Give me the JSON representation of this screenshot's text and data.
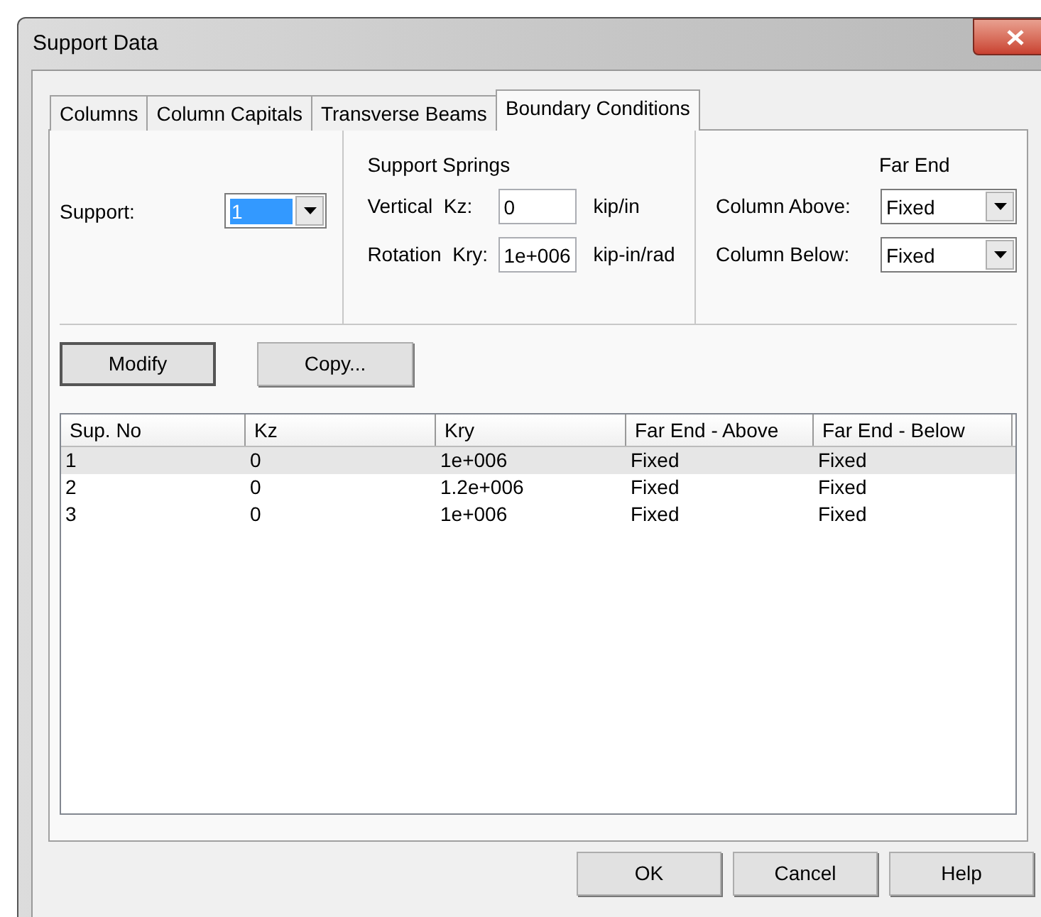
{
  "window": {
    "title": "Support Data"
  },
  "tabs": [
    {
      "label": "Columns",
      "selected": false
    },
    {
      "label": "Column Capitals",
      "selected": false
    },
    {
      "label": "Transverse Beams",
      "selected": false
    },
    {
      "label": "Boundary Conditions",
      "selected": true
    }
  ],
  "support": {
    "label": "Support:",
    "value": "1"
  },
  "springs": {
    "title": "Support Springs",
    "fields": [
      {
        "label": "Vertical  Kz:",
        "value": "0",
        "unit": "kip/in"
      },
      {
        "label": "Rotation  Kry:",
        "value": "1e+006",
        "unit": "kip-in/rad"
      }
    ]
  },
  "far_end": {
    "title": "Far End",
    "fields": [
      {
        "label": "Column Above:",
        "value": "Fixed"
      },
      {
        "label": "Column Below:",
        "value": "Fixed"
      }
    ]
  },
  "actions": [
    {
      "label": "Modify",
      "default": true
    },
    {
      "label": "Copy...",
      "default": false
    }
  ],
  "table": {
    "columns": [
      "Sup. No",
      "Kz",
      "Kry",
      "Far End - Above",
      "Far End - Below"
    ],
    "rows": [
      {
        "cells": [
          "1",
          "0",
          "1e+006",
          "Fixed",
          "Fixed"
        ],
        "selected": true
      },
      {
        "cells": [
          "2",
          "0",
          "1.2e+006",
          "Fixed",
          "Fixed"
        ],
        "selected": false
      },
      {
        "cells": [
          "3",
          "0",
          "1e+006",
          "Fixed",
          "Fixed"
        ],
        "selected": false
      }
    ]
  },
  "buttons": [
    "OK",
    "Cancel",
    "Help"
  ]
}
